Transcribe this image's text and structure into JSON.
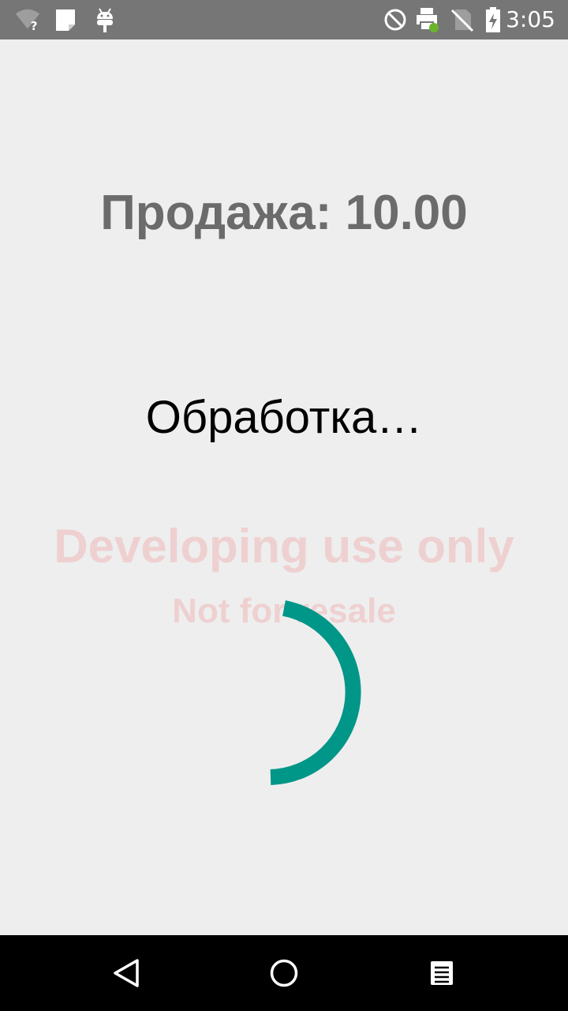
{
  "status_bar": {
    "time": "3:05",
    "left_icons": [
      "wifi-unknown-icon",
      "clipboard-icon",
      "android-debug-icon"
    ],
    "right_icons": [
      "do-not-disturb-icon",
      "printer-icon",
      "no-sim-icon",
      "battery-charging-icon"
    ],
    "colors": {
      "background": "#767676",
      "foreground": "#ffffff",
      "printer_badge": "#6ab42d"
    }
  },
  "main": {
    "sale_title": "Продажа: 10.00",
    "processing_label": "Обработка…",
    "watermark_line1": "Developing use only",
    "watermark_line2": "Not for resale",
    "spinner_color": "#009688"
  },
  "nav_bar": {
    "buttons": [
      "back-icon",
      "home-icon",
      "recents-icon"
    ]
  }
}
